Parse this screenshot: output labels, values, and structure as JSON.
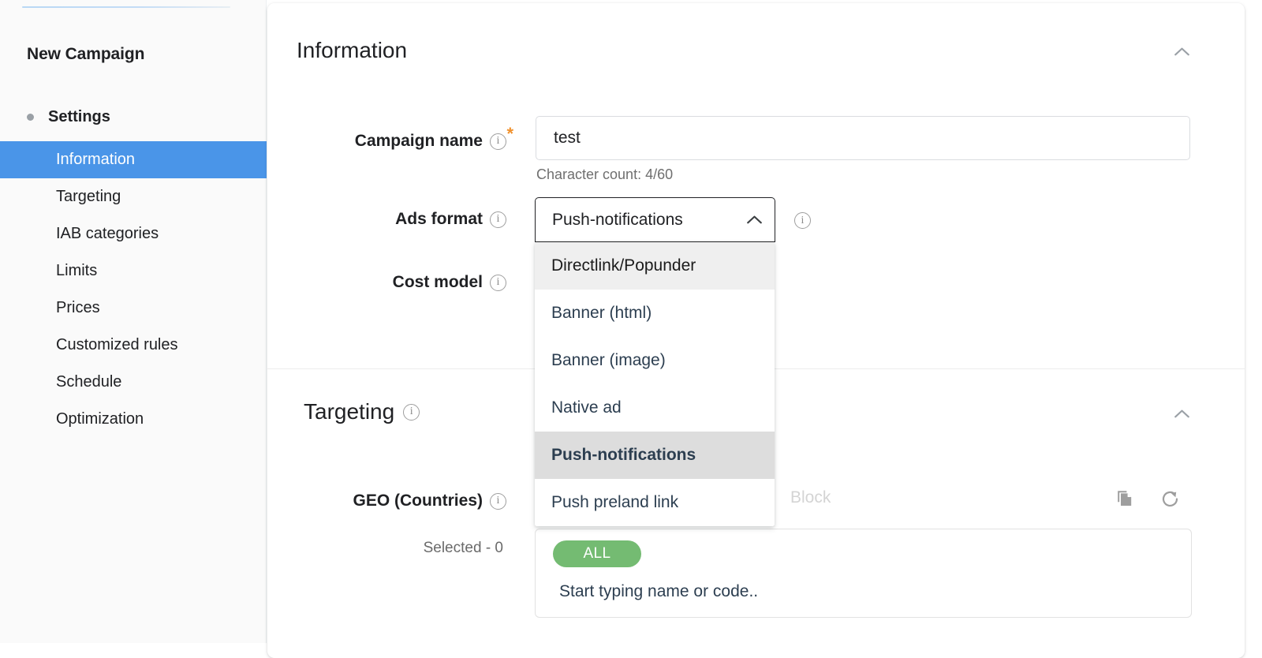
{
  "sidebar": {
    "title": "New Campaign",
    "group": {
      "label": "Settings",
      "bullet_icon": "bullet-dot-icon"
    },
    "items": [
      {
        "label": "Information",
        "active": true
      },
      {
        "label": "Targeting",
        "active": false
      },
      {
        "label": "IAB categories",
        "active": false
      },
      {
        "label": "Limits",
        "active": false
      },
      {
        "label": "Prices",
        "active": false
      },
      {
        "label": "Customized rules",
        "active": false
      },
      {
        "label": "Schedule",
        "active": false
      },
      {
        "label": "Optimization",
        "active": false
      }
    ],
    "active_color": "#4a95e8",
    "background": "#fafafa"
  },
  "information": {
    "title": "Information",
    "collapse_icon": "chevron-up-icon",
    "campaign_name": {
      "label": "Campaign name",
      "required_marker": "*",
      "info_icon": "info-icon",
      "value": "test",
      "placeholder": "",
      "character_count": "Character count: 4/60"
    },
    "ads_format": {
      "label": "Ads format",
      "info_icon": "info-icon",
      "selected": "Push-notifications",
      "chevron_icon": "chevron-up-icon",
      "trailing_info_icon": "info-icon",
      "options": [
        {
          "label": "Directlink/Popunder",
          "state": "hovered"
        },
        {
          "label": "Banner (html)",
          "state": "normal"
        },
        {
          "label": "Banner (image)",
          "state": "normal"
        },
        {
          "label": "Native ad",
          "state": "normal"
        },
        {
          "label": "Push-notifications",
          "state": "selected"
        },
        {
          "label": "Push preland link",
          "state": "normal"
        }
      ]
    },
    "cost_model": {
      "label": "Cost model",
      "info_icon": "info-icon"
    }
  },
  "targeting": {
    "title": "Targeting",
    "info_icon": "info-icon",
    "collapse_icon": "chevron-up-icon",
    "geo": {
      "label": "GEO (Countries)",
      "info_icon": "info-icon",
      "selected_text": "Selected - 0",
      "block_placeholder": "Block",
      "copy_icon": "copy-icon",
      "refresh_icon": "refresh-icon",
      "chips": [
        {
          "label": "ALL",
          "color": "#74bb72"
        }
      ],
      "typeahead_placeholder": "Start typing name or code.."
    }
  }
}
